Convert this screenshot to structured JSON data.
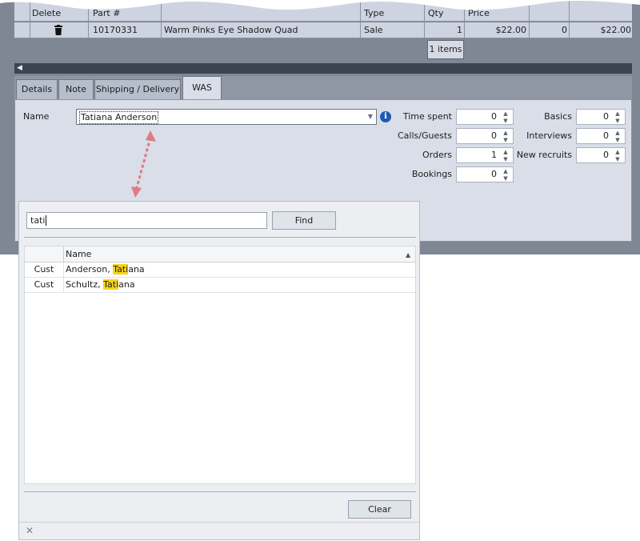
{
  "grid": {
    "columns": [
      "Delete",
      "Part #",
      "Type",
      "Qty",
      "Price"
    ],
    "row": {
      "part_no": "10170331",
      "description": "Warm Pinks Eye Shadow Quad",
      "type": "Sale",
      "qty": "1",
      "price": "$22.00",
      "discount": "0",
      "total": "$22.00"
    },
    "items_count_label": "1 items"
  },
  "tabs": [
    {
      "label": "Details",
      "active": false
    },
    {
      "label": "Note",
      "active": false
    },
    {
      "label": "Shipping / Delivery",
      "active": false
    },
    {
      "label": "WAS",
      "active": true
    }
  ],
  "was_panel": {
    "name_label": "Name",
    "name_value": "Tatiana Anderson",
    "fields_left": [
      {
        "label": "Time spent",
        "value": "0"
      },
      {
        "label": "Calls/Guests",
        "value": "0"
      },
      {
        "label": "Orders",
        "value": "1"
      },
      {
        "label": "Bookings",
        "value": "0"
      }
    ],
    "fields_right": [
      {
        "label": "Basics",
        "value": "0"
      },
      {
        "label": "Interviews",
        "value": "0"
      },
      {
        "label": "New recruits",
        "value": "0"
      }
    ]
  },
  "lookup_popup": {
    "search_value": "tati",
    "find_label": "Find",
    "column_name": "Name",
    "results": [
      {
        "type": "Cust",
        "name_before": "Anderson, ",
        "name_match": "Tati",
        "name_after": "ana"
      },
      {
        "type": "Cust",
        "name_before": "Schultz, ",
        "name_match": "Tati",
        "name_after": "ana"
      }
    ],
    "clear_label": "Clear"
  },
  "colors": {
    "highlight": "#f9d31c",
    "info_icon": "#1c5bb5",
    "annotation_arrow": "#e07a86"
  }
}
